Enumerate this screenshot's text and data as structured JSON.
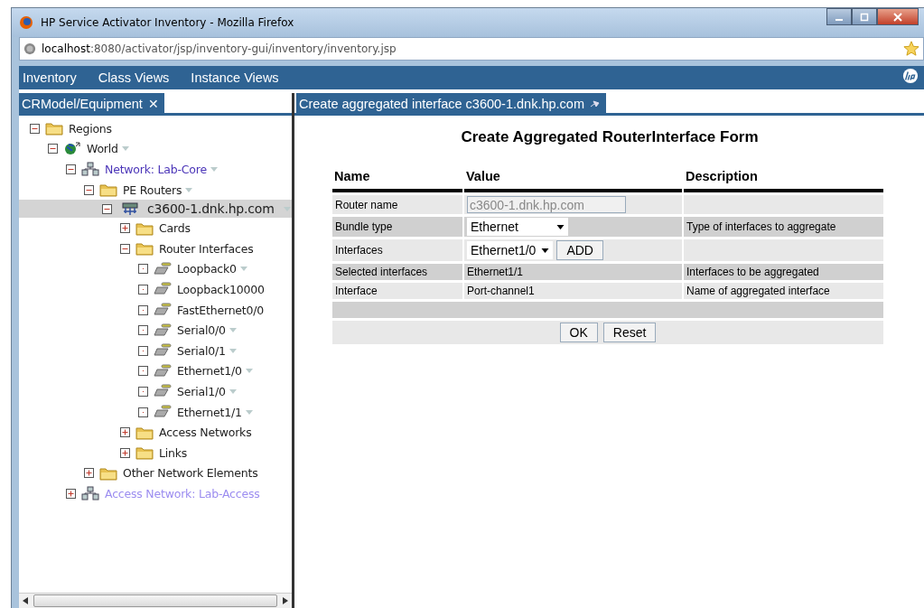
{
  "window": {
    "title": "HP Service Activator Inventory - Mozilla Firefox"
  },
  "address_bar": {
    "host": "localhost",
    "path": ":8080/activator/jsp/inventory-gui/inventory/inventory.jsp"
  },
  "menu": [
    "Inventory",
    "Class Views",
    "Instance Views"
  ],
  "left_tab": {
    "label": "CRModel/Equipment",
    "close": "✕"
  },
  "right_tab": {
    "label": "Create aggregated interface c3600-1.dnk.hp.com"
  },
  "tree": [
    {
      "label": "Regions",
      "kind": "folder",
      "expanded": true,
      "menu": false,
      "selected": false,
      "children": [
        {
          "label": "World",
          "kind": "globe",
          "expanded": true,
          "menu": true,
          "selected": false,
          "children": [
            {
              "label": "Network: Lab-Core",
              "kind": "network",
              "expanded": true,
              "menu": true,
              "selected": false,
              "color": "#4b35b8",
              "children": [
                {
                  "label": "PE Routers",
                  "kind": "folder",
                  "expanded": true,
                  "menu": true,
                  "selected": false,
                  "children": [
                    {
                      "label": "c3600-1.dnk.hp.com",
                      "kind": "router",
                      "expanded": true,
                      "menu": true,
                      "selected": true,
                      "children": [
                        {
                          "label": "Cards",
                          "kind": "folder",
                          "expanded": false,
                          "menu": false,
                          "selected": false
                        },
                        {
                          "label": "Router Interfaces",
                          "kind": "folder",
                          "expanded": true,
                          "menu": false,
                          "selected": false,
                          "children": [
                            {
                              "label": "Loopback0",
                              "kind": "interface",
                              "menu": true,
                              "selected": false
                            },
                            {
                              "label": "Loopback10000",
                              "kind": "interface",
                              "menu": false,
                              "selected": false
                            },
                            {
                              "label": "FastEthernet0/0",
                              "kind": "interface",
                              "menu": false,
                              "selected": false
                            },
                            {
                              "label": "Serial0/0",
                              "kind": "interface",
                              "menu": true,
                              "selected": false
                            },
                            {
                              "label": "Serial0/1",
                              "kind": "interface",
                              "menu": true,
                              "selected": false
                            },
                            {
                              "label": "Ethernet1/0",
                              "kind": "interface",
                              "menu": true,
                              "selected": false
                            },
                            {
                              "label": "Serial1/0",
                              "kind": "interface",
                              "menu": true,
                              "selected": false
                            },
                            {
                              "label": "Ethernet1/1",
                              "kind": "interface",
                              "menu": true,
                              "selected": false
                            }
                          ]
                        },
                        {
                          "label": "Access Networks",
                          "kind": "folder",
                          "expanded": false,
                          "menu": false,
                          "selected": false
                        },
                        {
                          "label": "Links",
                          "kind": "folder",
                          "expanded": false,
                          "menu": false,
                          "selected": false
                        }
                      ]
                    }
                  ]
                },
                {
                  "label": "Other Network Elements",
                  "kind": "folder",
                  "expanded": false,
                  "menu": false,
                  "selected": false
                }
              ]
            },
            {
              "label": "Access Network: Lab-Access",
              "kind": "network",
              "expanded": false,
              "menu": false,
              "selected": false,
              "color": "#9b8cf0"
            }
          ]
        }
      ]
    }
  ],
  "form": {
    "title": "Create Aggregated RouterInterface Form",
    "columns": [
      "Name",
      "Value",
      "Description"
    ],
    "rows": [
      {
        "name": "Router name",
        "kind": "input",
        "value": "c3600-1.dnk.hp.com",
        "disabled": true
      },
      {
        "name": "Bundle type",
        "kind": "select",
        "value": "Ethernet",
        "description": "Type of interfaces to aggregate"
      },
      {
        "name": "Interfaces",
        "kind": "select-add",
        "value": "Ethernet1/0",
        "button": "ADD"
      },
      {
        "name": "Selected interfaces",
        "kind": "text",
        "value": "Ethernet1/1",
        "description": "Interfaces to be aggregated"
      },
      {
        "name": "Interface",
        "kind": "text",
        "value": "Port-channel1",
        "description": "Name of aggregated interface"
      }
    ],
    "buttons": [
      "OK",
      "Reset"
    ]
  }
}
